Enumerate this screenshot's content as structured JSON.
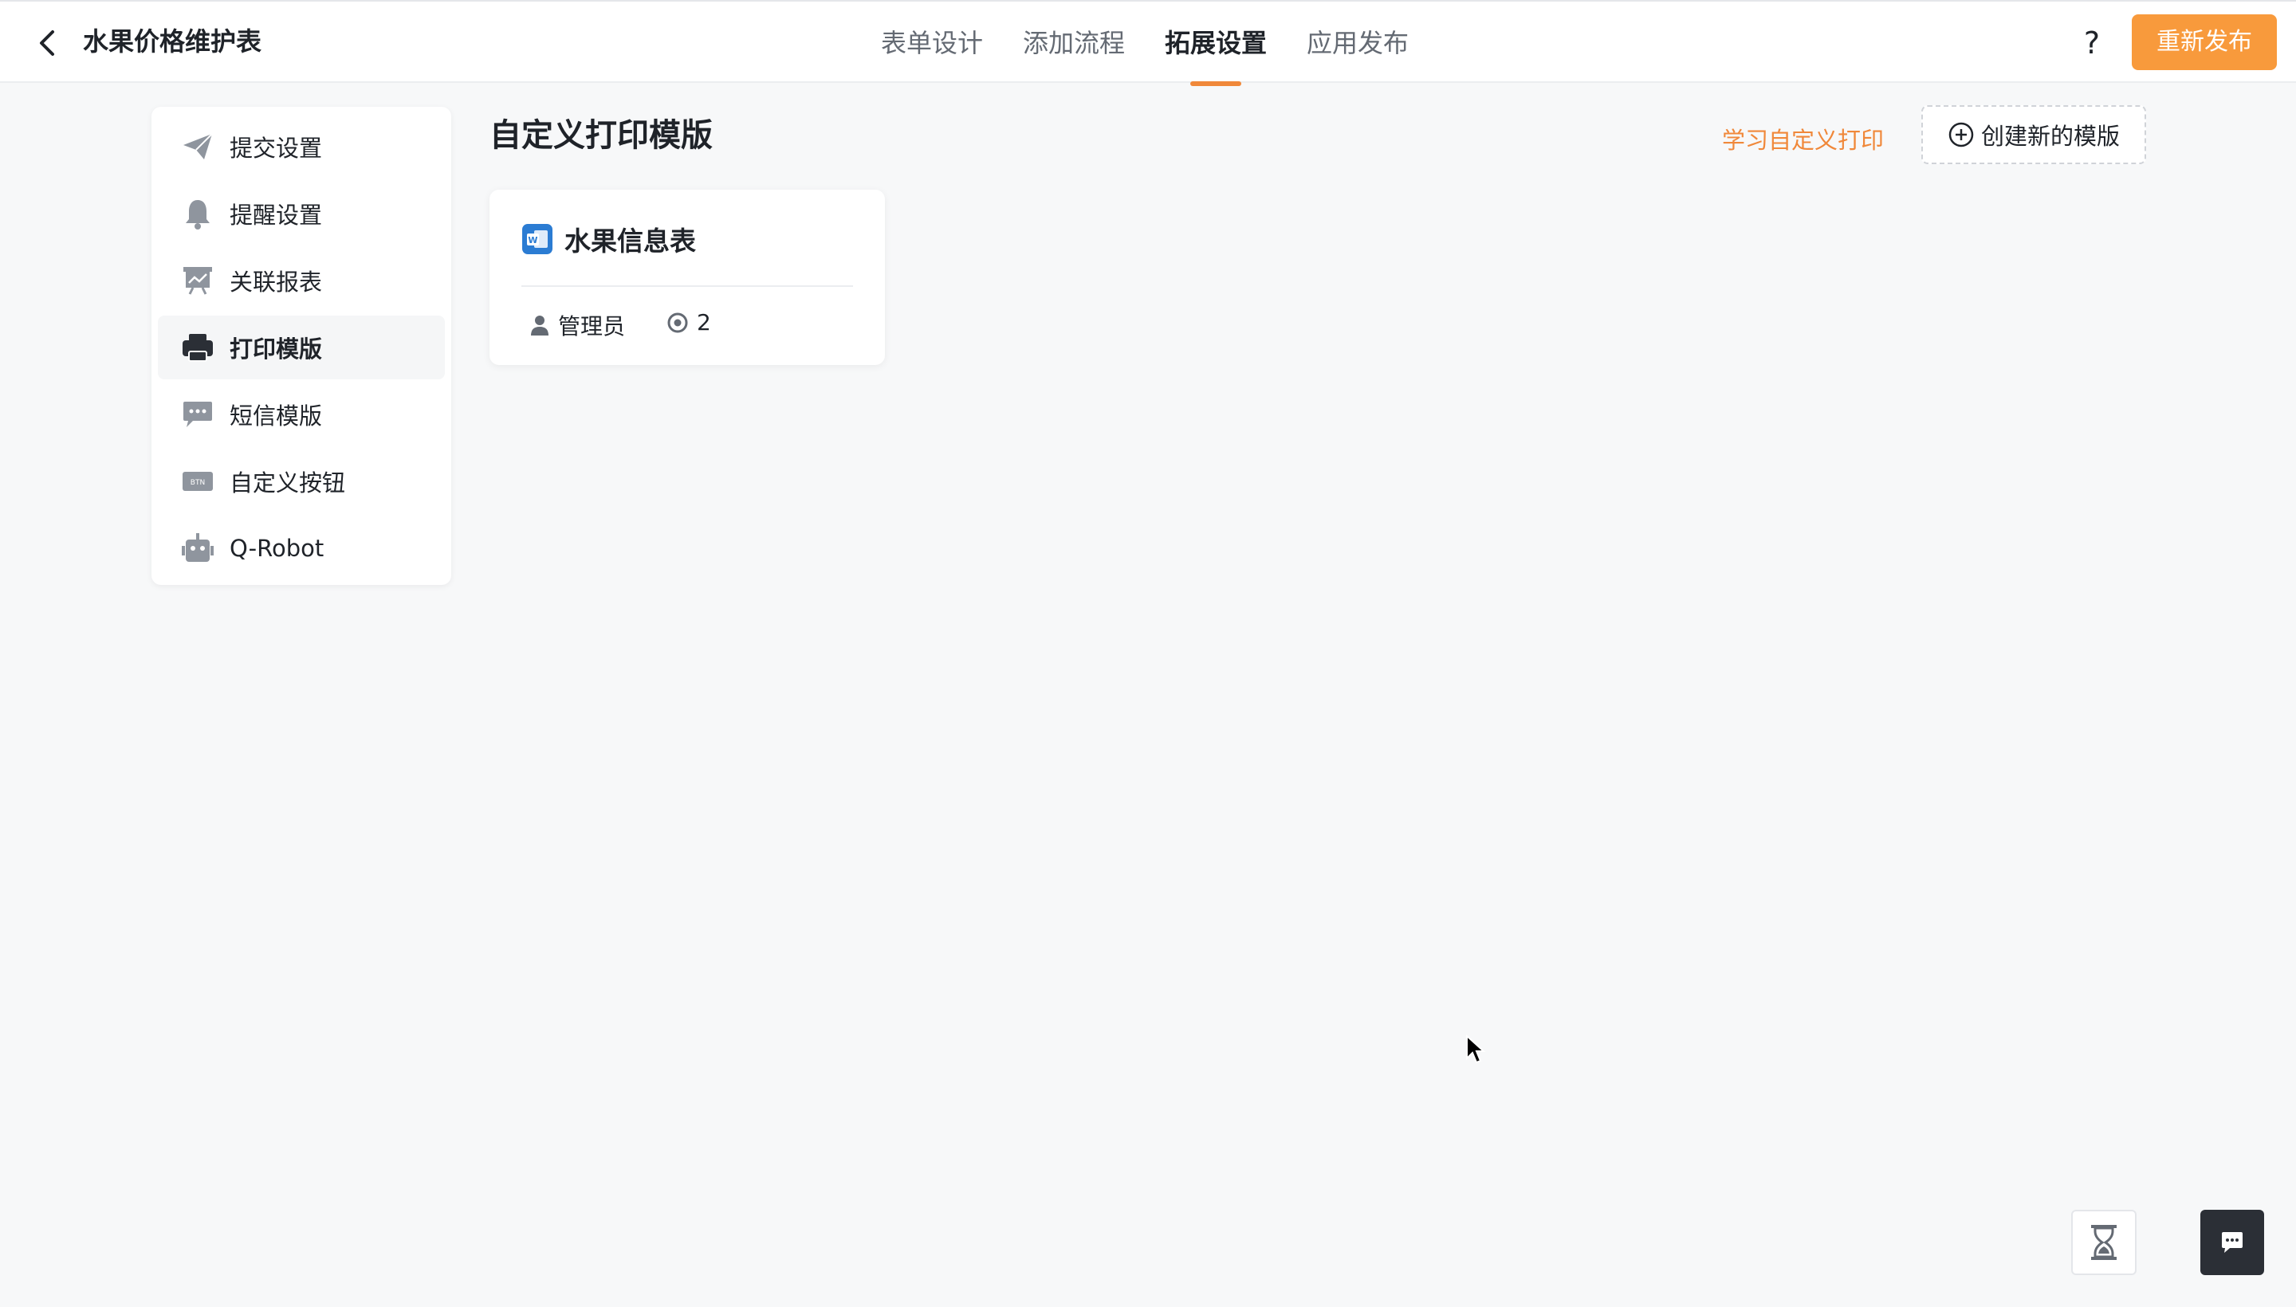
{
  "header": {
    "app_title": "水果价格维护表",
    "tabs": [
      {
        "label": "表单设计",
        "active": false
      },
      {
        "label": "添加流程",
        "active": false
      },
      {
        "label": "拓展设置",
        "active": true
      },
      {
        "label": "应用发布",
        "active": false
      }
    ],
    "help_label": "?",
    "publish_label": "重新发布"
  },
  "sidebar": {
    "items": [
      {
        "label": "提交设置",
        "icon": "paper-plane-icon",
        "active": false
      },
      {
        "label": "提醒设置",
        "icon": "bell-icon",
        "active": false
      },
      {
        "label": "关联报表",
        "icon": "presentation-chart-icon",
        "active": false
      },
      {
        "label": "打印模版",
        "icon": "printer-icon",
        "active": true
      },
      {
        "label": "短信模版",
        "icon": "message-bubble-icon",
        "active": false
      },
      {
        "label": "自定义按钮",
        "icon": "btn-tag-icon",
        "active": false
      },
      {
        "label": "Q-Robot",
        "icon": "robot-icon",
        "active": false
      }
    ]
  },
  "main": {
    "section_title": "自定义打印模版",
    "learn_link": "学习自定义打印",
    "create_button": "创建新的模版",
    "templates": [
      {
        "title": "水果信息表",
        "icon": "word-document-icon",
        "owner": "管理员",
        "count": "2"
      }
    ]
  },
  "colors": {
    "accent": "#f0883a",
    "publish_button": "#f89a3c",
    "word_icon": "#2b7cd3",
    "floating_dark": "#2b2f36"
  }
}
